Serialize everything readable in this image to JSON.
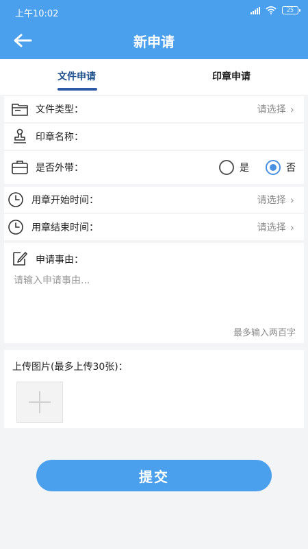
{
  "status_bar": {
    "time": "上午10:02",
    "battery": "25"
  },
  "header": {
    "title": "新申请"
  },
  "tabs": [
    {
      "label": "文件申请",
      "active": true
    },
    {
      "label": "印章申请",
      "active": false
    }
  ],
  "form": {
    "file_type": {
      "label": "文件类型：",
      "value": "请选择"
    },
    "seal_name": {
      "label": "印章名称："
    },
    "take_out": {
      "label": "是否外带：",
      "options": [
        "是",
        "否"
      ],
      "selected": "否"
    },
    "start_time": {
      "label": "用章开始时间：",
      "value": "请选择"
    },
    "end_time": {
      "label": "用章结束时间：",
      "value": "请选择"
    },
    "reason": {
      "label": "申请事由：",
      "placeholder": "请输入申请事由...",
      "hint": "最多输入两百字"
    },
    "upload": {
      "label": "上传图片(最多上传30张)："
    }
  },
  "submit_label": "提交",
  "colors": {
    "primary": "#4aa0ec",
    "tab_indicator": "#2e5aa8",
    "radio_checked": "#4a90e2"
  },
  "icons": [
    "back-arrow-icon",
    "folder-icon",
    "stamp-icon",
    "briefcase-icon",
    "clock-icon",
    "edit-icon",
    "plus-icon"
  ]
}
